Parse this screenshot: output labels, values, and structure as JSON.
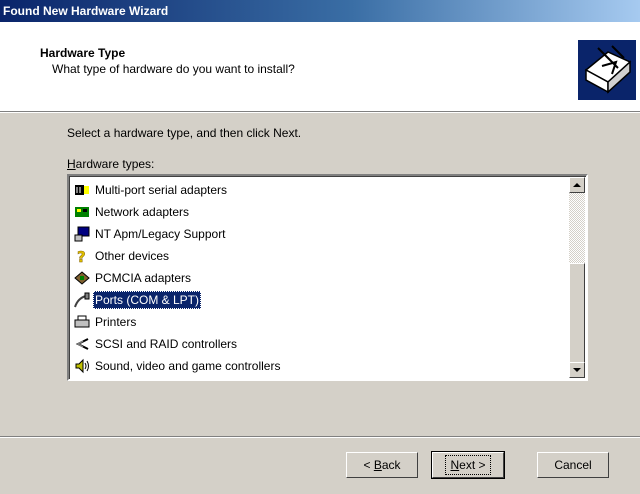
{
  "window": {
    "title": "Found New Hardware Wizard"
  },
  "header": {
    "title": "Hardware Type",
    "subtitle": "What type of hardware do you want to install?",
    "icon": "hardware-wizard-icon"
  },
  "body": {
    "instruction": "Select a hardware type, and then click Next.",
    "types_label_prefix": "H",
    "types_label_rest": "ardware types:"
  },
  "list": {
    "items": [
      {
        "label": "Multi-port serial adapters",
        "icon": "serial-adapter-icon"
      },
      {
        "label": "Network adapters",
        "icon": "network-adapter-icon"
      },
      {
        "label": "NT Apm/Legacy Support",
        "icon": "computer-icon"
      },
      {
        "label": "Other devices",
        "icon": "question-mark-icon"
      },
      {
        "label": "PCMCIA adapters",
        "icon": "pcmcia-icon"
      },
      {
        "label": "Ports (COM & LPT)",
        "icon": "port-cable-icon",
        "selected": true
      },
      {
        "label": "Printers",
        "icon": "printer-icon"
      },
      {
        "label": "SCSI and RAID controllers",
        "icon": "scsi-icon"
      },
      {
        "label": "Sound, video and game controllers",
        "icon": "speaker-icon"
      }
    ]
  },
  "buttons": {
    "back_prefix": "< ",
    "back_key": "B",
    "back_rest": "ack",
    "next_key": "N",
    "next_rest": "ext >",
    "cancel": "Cancel"
  }
}
